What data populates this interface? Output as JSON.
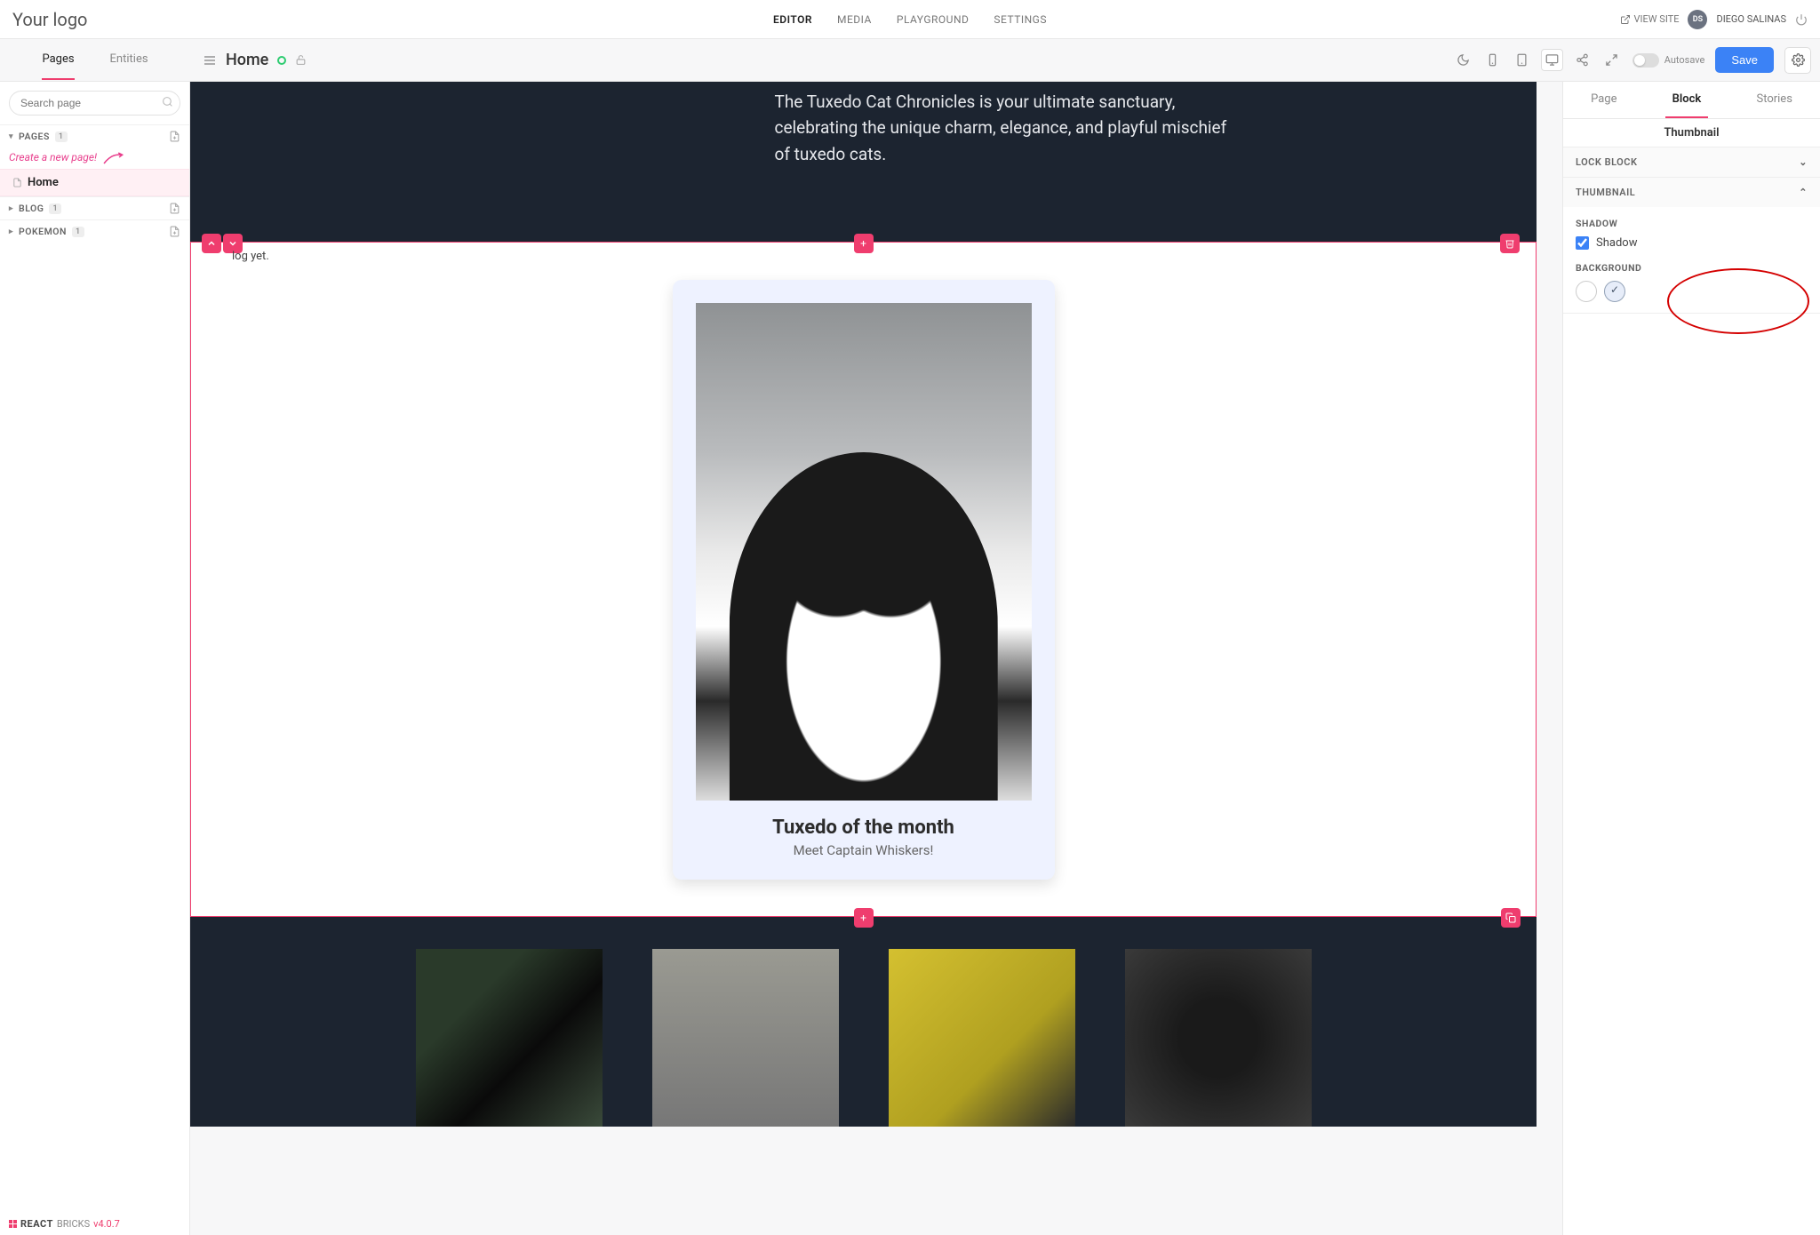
{
  "topbar": {
    "logo": "Your logo",
    "nav": {
      "editor": "EDITOR",
      "media": "MEDIA",
      "playground": "PLAYGROUND",
      "settings": "SETTINGS"
    },
    "view_site": "VIEW SITE",
    "avatar_initials": "DS",
    "username": "DIEGO SALINAS"
  },
  "left_tabs": {
    "pages": "Pages",
    "entities": "Entities"
  },
  "page_header": {
    "title": "Home"
  },
  "toolbar": {
    "autosave_label": "Autosave",
    "save_label": "Save"
  },
  "search": {
    "placeholder": "Search page"
  },
  "tree": {
    "pages_label": "PAGES",
    "pages_count": "1",
    "create_note": "Create a new page!",
    "home_label": "Home",
    "blog_label": "BLOG",
    "blog_count": "1",
    "pokemon_label": "POKEMON",
    "pokemon_count": "1"
  },
  "canvas": {
    "hero_text": "The Tuxedo Cat Chronicles is your ultimate sanctuary, celebrating the unique charm, elegance, and playful mischief of tuxedo cats.",
    "no_log": "log yet.",
    "thumb_title": "Tuxedo of the month",
    "thumb_sub": "Meet Captain Whiskers!"
  },
  "right": {
    "tabs": {
      "page": "Page",
      "block": "Block",
      "stories": "Stories"
    },
    "block_name": "Thumbnail",
    "lock_label": "LOCK BLOCK",
    "thumbnail_label": "THUMBNAIL",
    "shadow_label": "SHADOW",
    "shadow_check": "Shadow",
    "background_label": "BACKGROUND"
  },
  "footer": {
    "brand1": "REACT",
    "brand2": "BRICKS",
    "version": "v4.0.7"
  }
}
